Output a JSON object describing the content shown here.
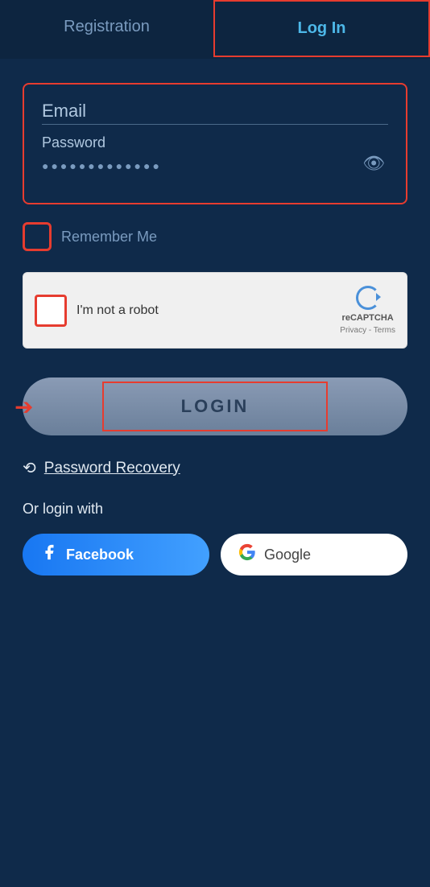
{
  "tabs": {
    "registration": "Registration",
    "login": "Log In"
  },
  "form": {
    "email_placeholder": "Email",
    "password_label": "Password",
    "password_dots": "●●●●●●●●●●●●●"
  },
  "remember_me": {
    "label": "Remember Me"
  },
  "recaptcha": {
    "text": "I'm not a robot",
    "brand": "reCAPTCHA",
    "links": "Privacy - Terms"
  },
  "login_button": {
    "label": "LOGIN"
  },
  "password_recovery": {
    "label": "Password Recovery"
  },
  "social": {
    "or_label": "Or login with",
    "facebook": "Facebook",
    "google": "Google"
  }
}
